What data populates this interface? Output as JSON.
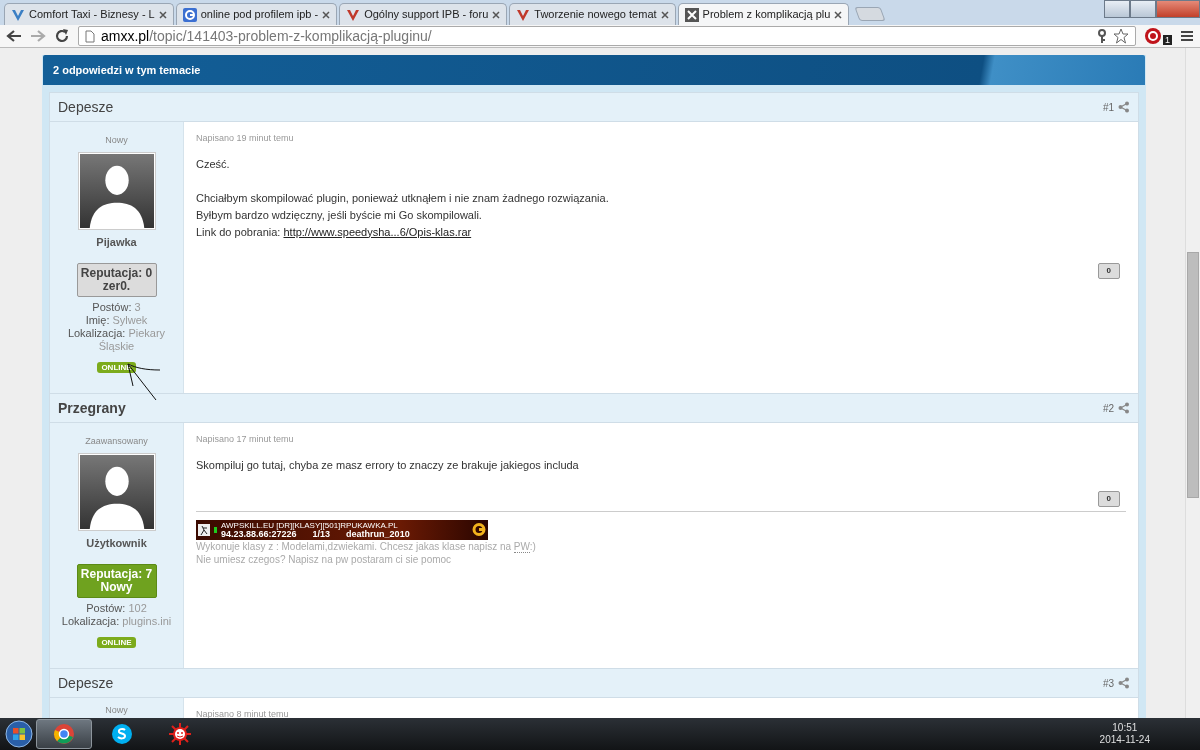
{
  "browser": {
    "tabs": [
      {
        "title": "Comfort Taxi - Biznesy - L",
        "kind": "vblue",
        "selected": false
      },
      {
        "title": "online pod profilem ipb -",
        "kind": "google",
        "selected": false
      },
      {
        "title": "Ogólny support IPB - foru",
        "kind": "vred",
        "selected": false
      },
      {
        "title": "Tworzenie nowego temat",
        "kind": "vred",
        "selected": false
      },
      {
        "title": "Problem z komplikacją plu",
        "kind": "x",
        "selected": true
      }
    ],
    "url": {
      "host": "amxx.pl",
      "path": "/topic/141403-problem-z-komplikacją-pluginu/"
    },
    "extension_badge": "1"
  },
  "topic_header": "2 odpowiedzi w tym temacie",
  "posts": [
    {
      "author": "Depesze",
      "author_bold": false,
      "number": "#1",
      "rank": "Nowy",
      "group": "Pijawka",
      "reputation": {
        "kind": "neutral",
        "label": "Reputacja: 0",
        "title": "zer0."
      },
      "details": [
        {
          "label": "Postów:",
          "value": "3"
        },
        {
          "label": "Imię:",
          "value": "Sylwek"
        },
        {
          "label": "Lokalizacja:",
          "value": "Piekary Śląskie"
        }
      ],
      "online": "ONLINE",
      "hand_drawn_arrow": true,
      "posted": "Napisano 19 minut temu",
      "paragraphs": [
        {
          "lines": [
            {
              "text": "Cześć."
            }
          ]
        },
        {
          "lines": [
            {
              "text": "Chciałbym skompilować plugin, ponieważ utknąłem i nie znam żadnego rozwiązania."
            },
            {
              "text": "Byłbym bardzo wdzięczny, jeśli byście mi Go skompilowali."
            },
            {
              "text": "Link do pobrania:",
              "link": "http://www.speedysha...6/Opis-klas.rar"
            }
          ]
        }
      ],
      "likes": "0"
    },
    {
      "author": "Przegrany",
      "author_bold": true,
      "number": "#2",
      "rank": "Zaawansowany",
      "group": "Użytkownik",
      "reputation": {
        "kind": "positive",
        "label": "Reputacja: 7",
        "title": "Nowy"
      },
      "details": [
        {
          "label": "Postów:",
          "value": "102"
        },
        {
          "label": "Lokalizacja:",
          "value": "plugins.ini"
        }
      ],
      "online": "ONLINE",
      "posted": "Napisano 17 minut temu",
      "paragraphs": [
        {
          "lines": [
            {
              "text": "Skompiluj go tutaj, chyba ze masz errory to znaczy ze brakuje jakiegos includa"
            }
          ]
        }
      ],
      "likes": "0",
      "signature": {
        "banner": {
          "line1": "AWPSKILL.EU [DR][KLASY][501]RPUKAWKA.PL",
          "address": "94.23.88.66:27226",
          "players": "1/13",
          "map": "deathrun_2010"
        },
        "lines": [
          {
            "text": "Wykonuje klasy z : Modelami,dzwiekami. Chcesz jakas klase napisz na",
            "abbr": "PW",
            "after": ":)"
          },
          {
            "text": "Nie umiesz czegos? Napisz na pw postaram ci sie pomoc"
          }
        ]
      }
    },
    {
      "author": "Depesze",
      "author_bold": false,
      "number": "#3",
      "rank": "Nowy",
      "posted": "Napisano 8 minut temu"
    }
  ],
  "taskbar": {
    "apps": [
      {
        "kind": "chrome",
        "selected": true
      },
      {
        "kind": "skype",
        "selected": false
      },
      {
        "kind": "sun",
        "selected": false
      }
    ],
    "time": "10:51",
    "date": "2014-11-24"
  }
}
